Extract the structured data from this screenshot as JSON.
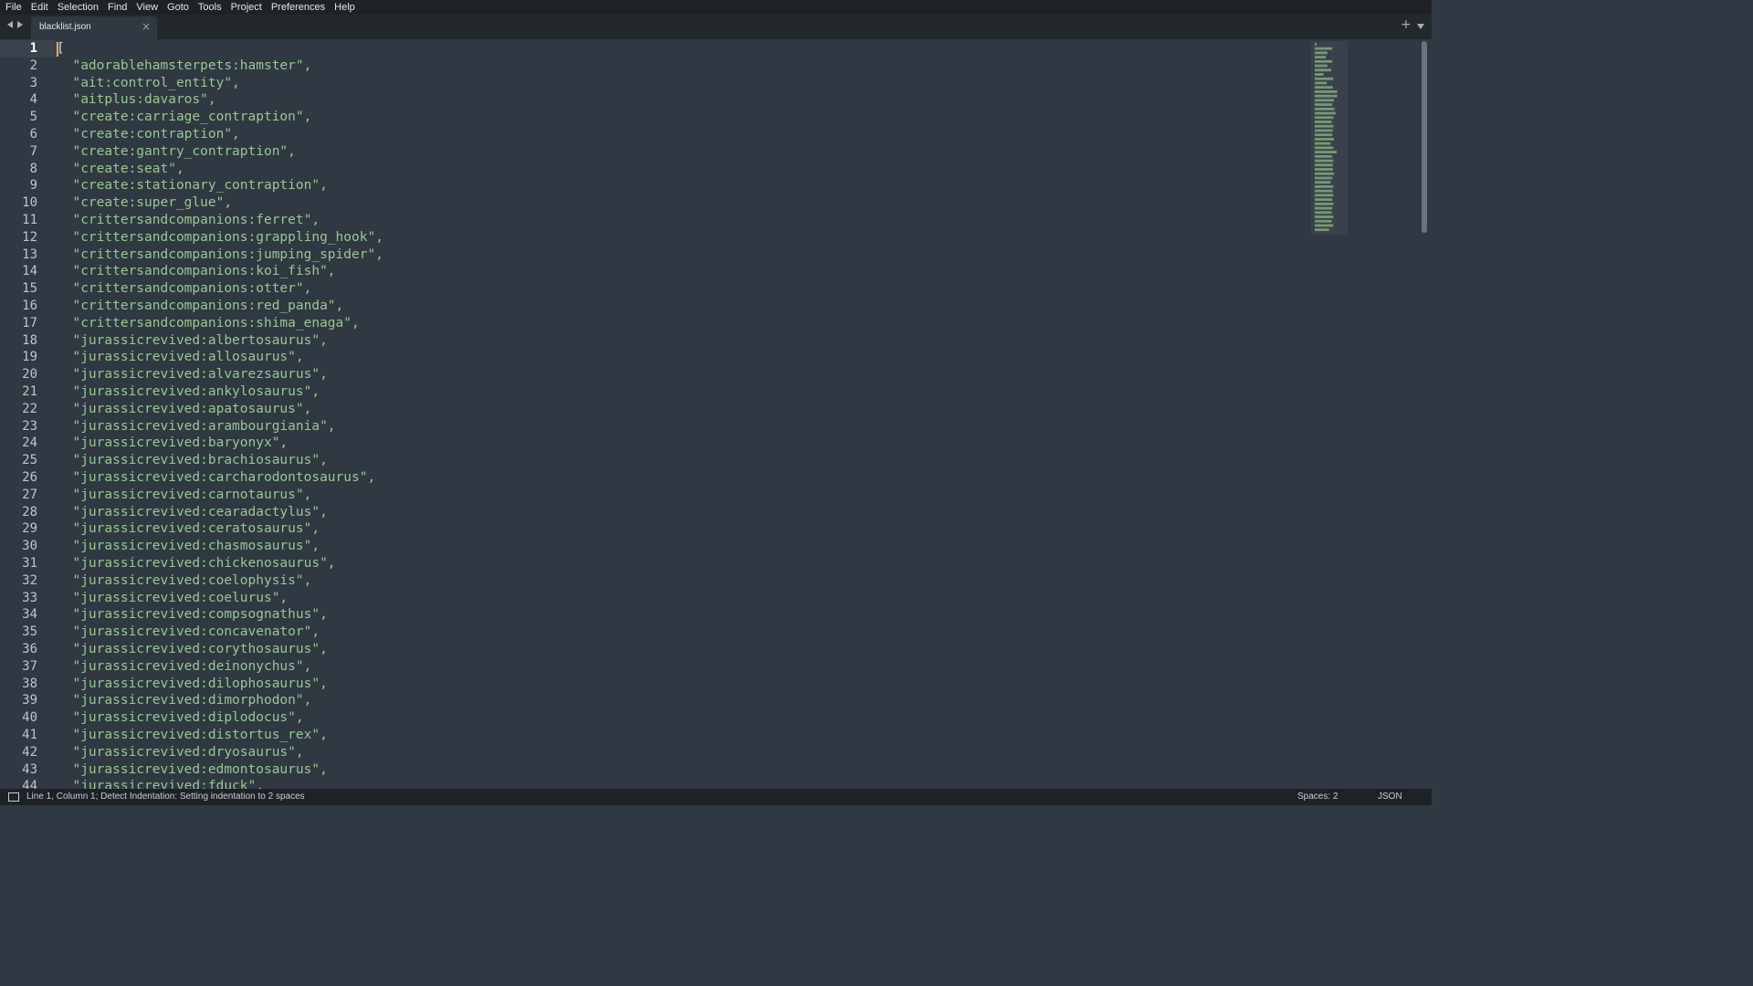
{
  "menu": [
    "File",
    "Edit",
    "Selection",
    "Find",
    "View",
    "Goto",
    "Tools",
    "Project",
    "Preferences",
    "Help"
  ],
  "tab": {
    "filename": "blacklist.json",
    "close_glyph": "×"
  },
  "new_tab_glyph": "+",
  "editor": {
    "active_line": 1,
    "lines": [
      "[",
      "  \"adorablehamsterpets:hamster\",",
      "  \"ait:control_entity\",",
      "  \"aitplus:davaros\",",
      "  \"create:carriage_contraption\",",
      "  \"create:contraption\",",
      "  \"create:gantry_contraption\",",
      "  \"create:seat\",",
      "  \"create:stationary_contraption\",",
      "  \"create:super_glue\",",
      "  \"crittersandcompanions:ferret\",",
      "  \"crittersandcompanions:grappling_hook\",",
      "  \"crittersandcompanions:jumping_spider\",",
      "  \"crittersandcompanions:koi_fish\",",
      "  \"crittersandcompanions:otter\",",
      "  \"crittersandcompanions:red_panda\",",
      "  \"crittersandcompanions:shima_enaga\",",
      "  \"jurassicrevived:albertosaurus\",",
      "  \"jurassicrevived:allosaurus\",",
      "  \"jurassicrevived:alvarezsaurus\",",
      "  \"jurassicrevived:ankylosaurus\",",
      "  \"jurassicrevived:apatosaurus\",",
      "  \"jurassicrevived:arambourgiania\",",
      "  \"jurassicrevived:baryonyx\",",
      "  \"jurassicrevived:brachiosaurus\",",
      "  \"jurassicrevived:carcharodontosaurus\",",
      "  \"jurassicrevived:carnotaurus\",",
      "  \"jurassicrevived:cearadactylus\",",
      "  \"jurassicrevived:ceratosaurus\",",
      "  \"jurassicrevived:chasmosaurus\",",
      "  \"jurassicrevived:chickenosaurus\",",
      "  \"jurassicrevived:coelophysis\",",
      "  \"jurassicrevived:coelurus\",",
      "  \"jurassicrevived:compsognathus\",",
      "  \"jurassicrevived:concavenator\",",
      "  \"jurassicrevived:corythosaurus\",",
      "  \"jurassicrevived:deinonychus\",",
      "  \"jurassicrevived:dilophosaurus\",",
      "  \"jurassicrevived:dimorphodon\",",
      "  \"jurassicrevived:diplodocus\",",
      "  \"jurassicrevived:distortus_rex\",",
      "  \"jurassicrevived:dryosaurus\",",
      "  \"jurassicrevived:edmontosaurus\",",
      "  \"jurassicrevived:fduck\","
    ]
  },
  "status": {
    "message": "Line 1, Column 1; Detect Indentation: Setting indentation to 2 spaces",
    "indentation": "Spaces: 2",
    "syntax": "JSON"
  },
  "colors": {
    "background": "#303841",
    "string": "#99c794",
    "cursor": "#f9ae58",
    "chrome": "#1e2226"
  },
  "icons": {
    "nav_left": "triangle-left",
    "nav_right": "triangle-right",
    "tab_menu": "triangle-down",
    "panel_toggle": "square-outline"
  }
}
